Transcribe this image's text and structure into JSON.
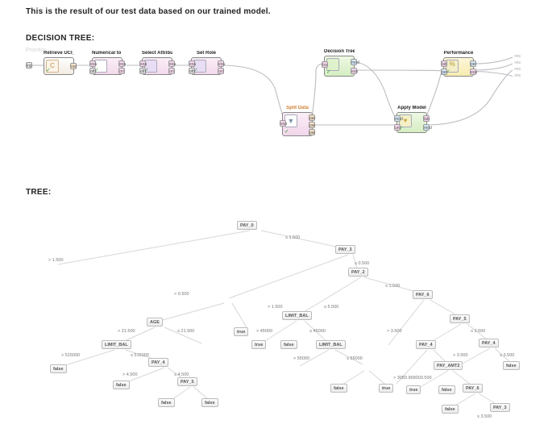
{
  "intro": "This is the result of our test data based on our trained model.",
  "sections": {
    "process_title": "DECISION TREE:",
    "tree_title": "TREE:",
    "process_subtitle": "Process"
  },
  "process": {
    "inp_port": "inp",
    "endpoints": {
      "res1": "res",
      "res2": "res",
      "res3": "res",
      "res4": "res"
    },
    "ops": [
      {
        "id": "retrieve",
        "title": "Retrieve UCI_Credi...",
        "ports": {
          "out": "out"
        }
      },
      {
        "id": "n2b",
        "title": "Numerical to Binomi...",
        "ports": {
          "l1": "exa",
          "l2": "oth",
          "r1": "exa",
          "r2": "ori"
        }
      },
      {
        "id": "selattr",
        "title": "Select Attributes",
        "ports": {
          "l1": "exa",
          "l2": "oth",
          "r1": "exa",
          "r2": "ori"
        }
      },
      {
        "id": "setrole",
        "title": "Set Role",
        "ports": {
          "l1": "exa",
          "l2": "oth",
          "r1": "exa",
          "r2": "ori"
        }
      },
      {
        "id": "dtree",
        "title": "Decision Tree",
        "ports": {
          "l1": "tra",
          "r1": "mod",
          "r2": "exa"
        }
      },
      {
        "id": "perf",
        "title": "Performance",
        "ports": {
          "l1": "lab",
          "l2": "per",
          "r1": "per",
          "r2": "exa"
        }
      },
      {
        "id": "split",
        "title": "Split Data",
        "ports": {
          "l1": "exa",
          "r1": "par",
          "r2": "par",
          "r3": "par"
        }
      },
      {
        "id": "apply",
        "title": "Apply Model",
        "ports": {
          "l1": "mod",
          "l2": "unl",
          "r1": "lab",
          "r2": "mod"
        }
      }
    ]
  },
  "tree": {
    "nodes": [
      {
        "id": "pay0",
        "label": "PAY_0"
      },
      {
        "id": "pay3",
        "label": "PAY_3"
      },
      {
        "id": "pay2",
        "label": "PAY_2"
      },
      {
        "id": "pay6a",
        "label": "PAY_6"
      },
      {
        "id": "age",
        "label": "AGE"
      },
      {
        "id": "lb1",
        "label": "LIMIT_BAL"
      },
      {
        "id": "lb2",
        "label": "LIMIT_BAL"
      },
      {
        "id": "lb3",
        "label": "LIMIT_BAL"
      },
      {
        "id": "pay5a",
        "label": "PAY_5"
      },
      {
        "id": "pay4a",
        "label": "PAY_4"
      },
      {
        "id": "pay4b",
        "label": "PAY_4"
      },
      {
        "id": "pay4c",
        "label": "PAY_4"
      },
      {
        "id": "pay5b",
        "label": "PAY_5"
      },
      {
        "id": "payamt2",
        "label": "PAY_AMT2"
      },
      {
        "id": "pay6b",
        "label": "PAY_6"
      },
      {
        "id": "pay3b",
        "label": "PAY_3"
      }
    ],
    "leaves": {
      "true": "true",
      "false": "false"
    },
    "edge_labels": {
      "e0l": "> 1.500",
      "e0r": "≤ 1.500",
      "e1r": "≤ 0.500",
      "e1l": "> 0.500",
      "e2r": "≤ 1.500",
      "e2l": "> 1.500",
      "e3l": "> 21.500",
      "e3r": "≤ 21.500",
      "e4l": "> 515000",
      "e4r": "≤ 515000",
      "e5l": "> 4.500",
      "e5r": "≤ 4.500",
      "e6l": "> 45000",
      "e6r": "≤ 45000",
      "e7l": "> 5.500",
      "e7r": "≤ 5.500",
      "e8l": "> 55000",
      "e8r": "≤ 55000",
      "e9l": "> 3.500",
      "e9r": "≤ 3.500",
      "e10l": "> 3.500",
      "e10r": "≤ 3.500",
      "e11l": "> 3083.968003.500",
      "e11r": "≤ 3.500",
      "e12l": "true",
      "e12r": "false"
    }
  }
}
